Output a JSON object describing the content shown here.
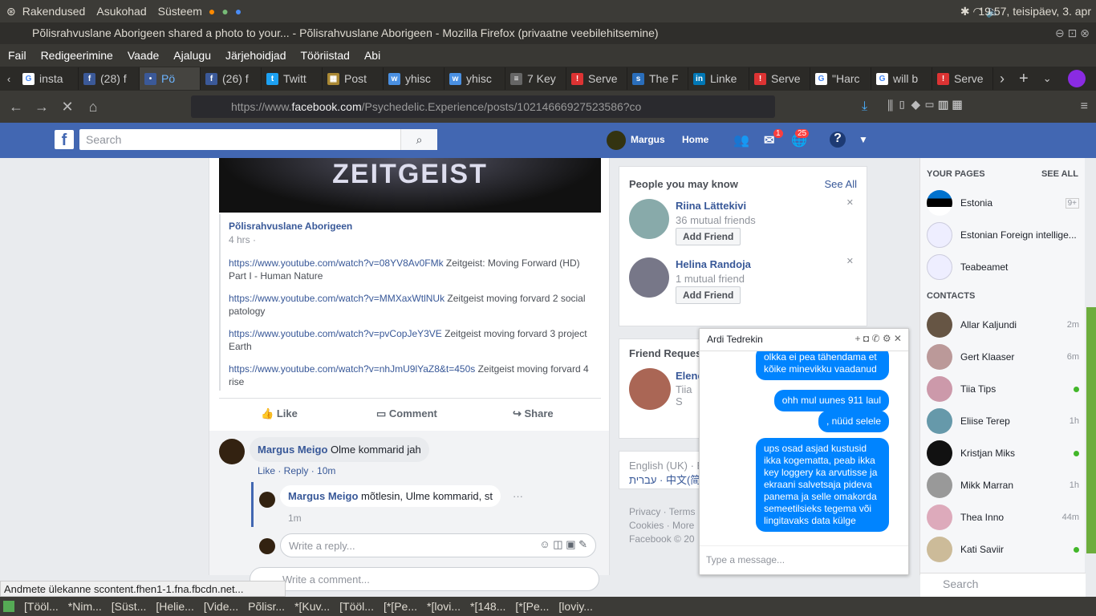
{
  "system": {
    "apps_menu": "Rakendused",
    "places_menu": "Asukohad",
    "system_menu": "Süsteem",
    "clock": "19:57, teisipäev,  3. apr"
  },
  "window": {
    "title": "Põlisrahvuslane Aborigeen shared a photo to your... - Põlisrahvuslane Aborigeen - Mozilla Firefox (privaatne veebilehitsemine)"
  },
  "menu": [
    "Fail",
    "Redigeerimine",
    "Vaade",
    "Ajalugu",
    "Järjehoidjad",
    "Tööriistad",
    "Abi"
  ],
  "tabs": [
    {
      "label": "insta",
      "color": "#fff",
      "glyph": "G"
    },
    {
      "label": "(28) f",
      "color": "#3b5998",
      "glyph": "f"
    },
    {
      "label": "Pö",
      "color": "#3b5998",
      "glyph": "•"
    },
    {
      "label": "(26) f",
      "color": "#3b5998",
      "glyph": "f"
    },
    {
      "label": "Twitt",
      "color": "#1da1f2",
      "glyph": "t"
    },
    {
      "label": "Post",
      "color": "#a83",
      "glyph": "▦"
    },
    {
      "label": "yhisc",
      "color": "#4a90e2",
      "glyph": "w"
    },
    {
      "label": "yhisc",
      "color": "#4a90e2",
      "glyph": "w"
    },
    {
      "label": "7 Key",
      "color": "#666",
      "glyph": "≡"
    },
    {
      "label": "Serve",
      "color": "#d33",
      "glyph": "!"
    },
    {
      "label": "The F",
      "color": "#2a6ebb",
      "glyph": "s"
    },
    {
      "label": "Linke",
      "color": "#0077b5",
      "glyph": "in"
    },
    {
      "label": "Serve",
      "color": "#d33",
      "glyph": "!"
    },
    {
      "label": "\"Harc",
      "color": "#fff",
      "glyph": "G"
    },
    {
      "label": "will b",
      "color": "#fff",
      "glyph": "G"
    },
    {
      "label": "Serve",
      "color": "#d33",
      "glyph": "!"
    }
  ],
  "url": {
    "prefix": "https://www.",
    "domain": "facebook.com",
    "path": "/Psychedelic.Experience/posts/10214666927523586?co"
  },
  "fb": {
    "search_placeholder": "Search",
    "user": "Margus",
    "home": "Home",
    "msg_count": "1",
    "notif_count": "25"
  },
  "post": {
    "author": "Põlisrahvuslane Aborigeen",
    "time": "4 hrs ·",
    "image_text": "ZEITGEIST",
    "links": [
      {
        "url": "https://www.youtube.com/watch?v=08YV8Av0FMk",
        "text": " Zeitgeist: Moving Forward (HD) Part I - Human Nature"
      },
      {
        "url": "https://www.youtube.com/watch?v=MMXaxWtlNUk",
        "text": " Zeitgeist moving forvard 2 social patology"
      },
      {
        "url": "https://www.youtube.com/watch?v=pvCopJeY3VE",
        "text": " Zeitgeist moving forvard 3 project Earth"
      },
      {
        "url": "https://www.youtube.com/watch?v=nhJmU9lYaZ8&t=450s",
        "text": " Zeitgeist moving forvard 4 rise"
      }
    ],
    "like": "Like",
    "comment": "Comment",
    "share": "Share"
  },
  "comments": [
    {
      "author": "Margus Meigo",
      "text": " Olme kommarid jah",
      "actions": "Like · Reply · 10m"
    },
    {
      "author": "Margus Meigo",
      "text": " mõtlesin, Ulme kommarid, st",
      "time": "1m"
    }
  ],
  "reply_placeholder": "Write a reply...",
  "comment_placeholder": "Write a comment...",
  "pymk": {
    "title": "People you may know",
    "see_all": "See All",
    "people": [
      {
        "name": "Riina Lättekivi",
        "mutual": "36 mutual friends",
        "btn": "Add Friend",
        "color": "#8aa"
      },
      {
        "name": "Helina Randoja",
        "mutual": "1 mutual friend",
        "btn": "Add Friend",
        "color": "#778"
      }
    ]
  },
  "friend_req": {
    "title": "Friend Reques",
    "name": "Elene",
    "sub": "Tiia S"
  },
  "footer": {
    "lang": "English (UK) · E",
    "lang2": "עברית · 中文(简",
    "links1": "Privacy · Terms",
    "links2": "Cookies · More",
    "copy": "Facebook © 20"
  },
  "your_pages": {
    "title": "YOUR PAGES",
    "see_all": "SEE ALL",
    "pages": [
      {
        "name": "Estonia",
        "badge": "9+"
      },
      {
        "name": "Estonian Foreign intellige...",
        "badge": ""
      },
      {
        "name": "Teabeamet",
        "badge": ""
      }
    ]
  },
  "contacts": {
    "title": "CONTACTS",
    "people": [
      {
        "name": "Allar Kaljundi",
        "status": "2m",
        "color": "#654"
      },
      {
        "name": "Gert Klaaser",
        "status": "6m",
        "color": "#b99"
      },
      {
        "name": "Tiia Tips",
        "status": "online",
        "color": "#c9a"
      },
      {
        "name": "Eliise Terep",
        "status": "1h",
        "color": "#69a"
      },
      {
        "name": "Kristjan Miks",
        "status": "online",
        "color": "#111"
      },
      {
        "name": "Mikk Marran",
        "status": "1h",
        "color": "#999"
      },
      {
        "name": "Thea Inno",
        "status": "44m",
        "color": "#dab"
      },
      {
        "name": "Kati Saviir",
        "status": "online",
        "color": "#cb9"
      }
    ],
    "search": "Search"
  },
  "chat": {
    "name": "Ardi Tedrekin",
    "messages": [
      "olkka ei pea tähendama et kõike minevikku vaadanud",
      "ohh mul uunes 911 laul",
      ", nüüd selele",
      "ups osad asjad kustusid ikka kogematta, peab ikka key loggery ka arvutisse ja ekraani salvetsaja pideva panema ja selle omakorda semeetilsieks tegema või lingitavaks data külge"
    ],
    "placeholder": "Type a message..."
  },
  "status_text": "Andmete ülekanne scontent.fhen1-1.fna.fbcdn.net...",
  "taskbar": [
    "[Tööl...",
    "*Nim...",
    "[Süst...",
    "[Helie...",
    "[Vide...",
    "Põlisr...",
    "*[Kuv...",
    "[Tööl...",
    "[*[Pe...",
    "*[lovi...",
    "*[148...",
    "[*[Pe...",
    "[loviy..."
  ]
}
